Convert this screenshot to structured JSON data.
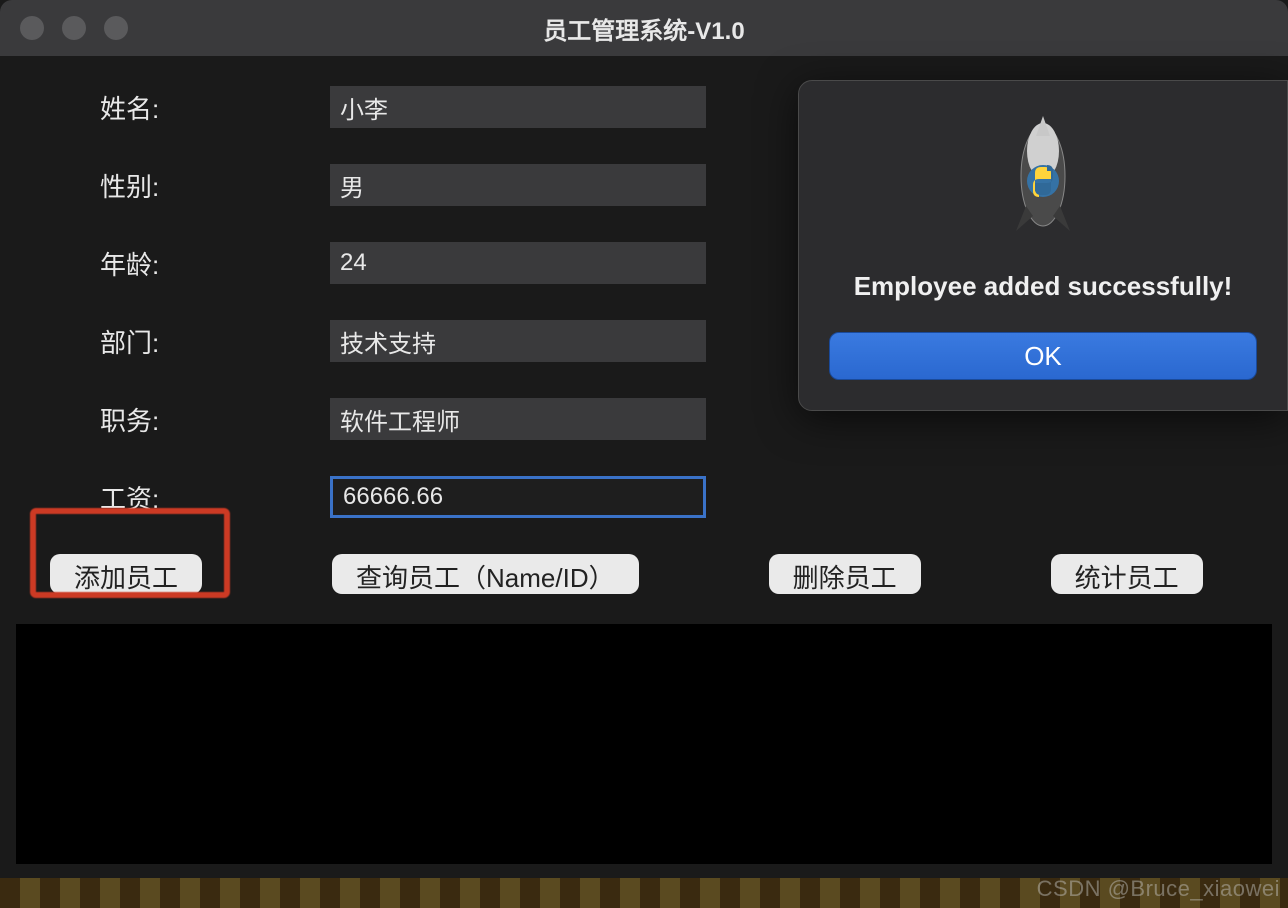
{
  "window": {
    "title": "员工管理系统-V1.0"
  },
  "form": {
    "fields": [
      {
        "label": "姓名:",
        "value": "小李"
      },
      {
        "label": "性别:",
        "value": "男"
      },
      {
        "label": "年龄:",
        "value": "24"
      },
      {
        "label": "部门:",
        "value": "技术支持"
      },
      {
        "label": "职务:",
        "value": "软件工程师"
      },
      {
        "label": "工资:",
        "value": "66666.66"
      }
    ]
  },
  "buttons": {
    "add": "添加员工",
    "query": "查询员工（Name/ID）",
    "delete": "删除员工",
    "stats": "统计员工"
  },
  "dialog": {
    "message": "Employee added successfully!",
    "ok": "OK"
  },
  "watermark": "CSDN @Bruce_xiaowei"
}
